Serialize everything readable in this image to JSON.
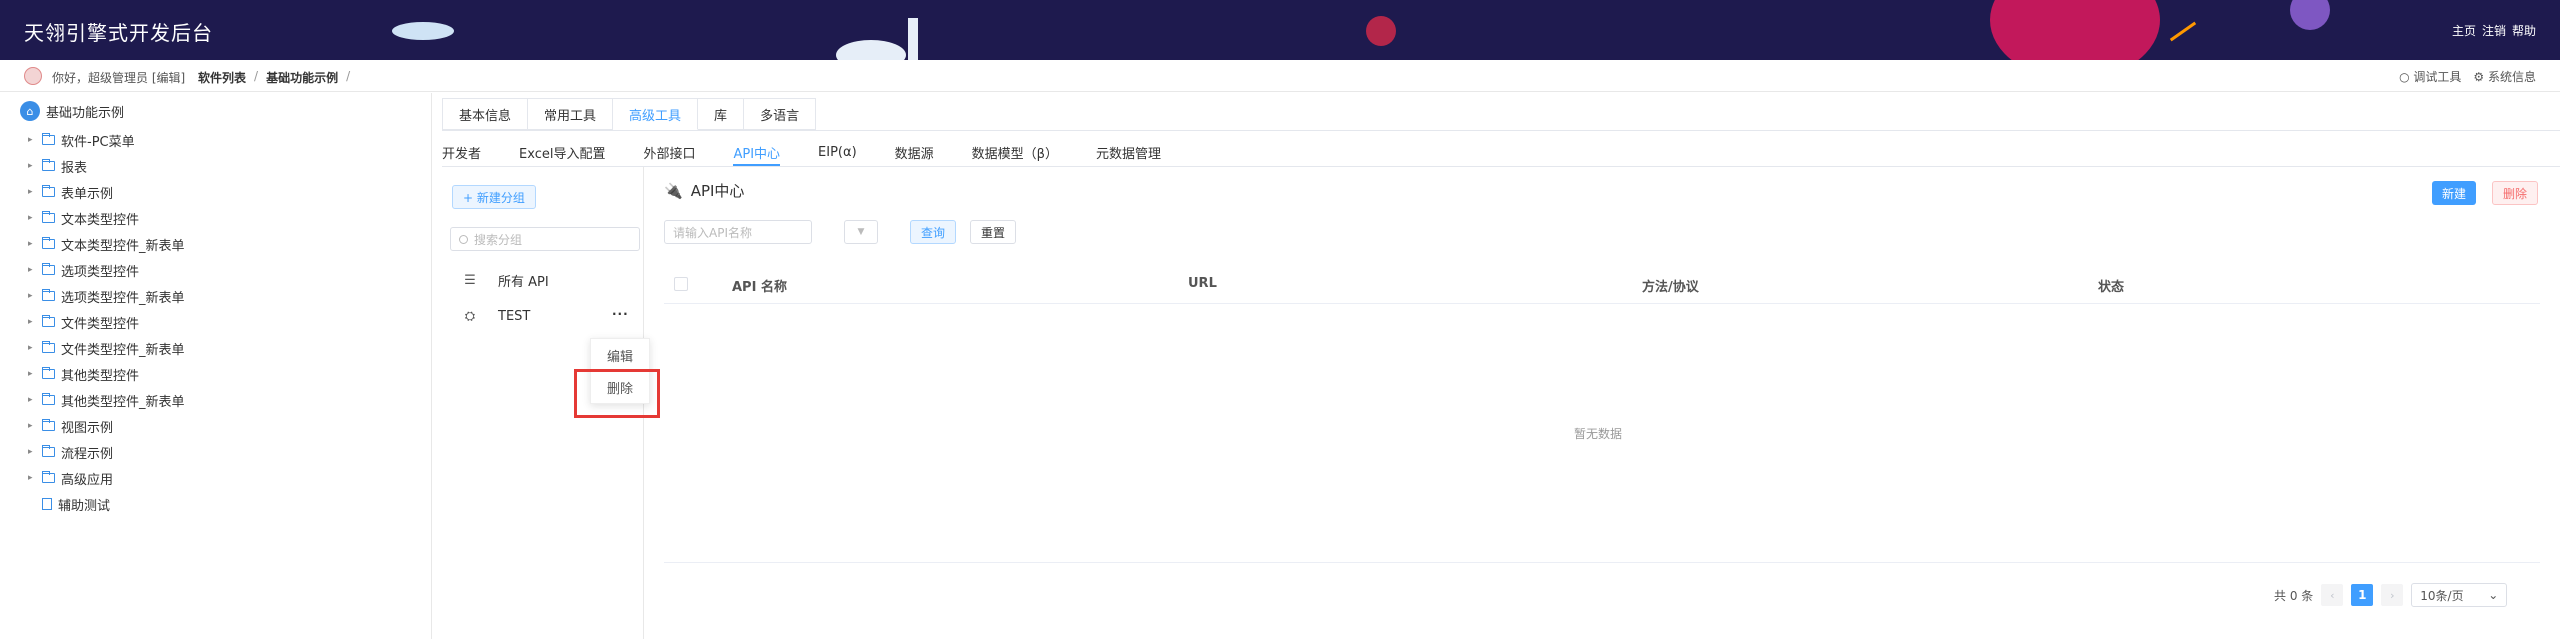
{
  "header": {
    "title": "天翎引擎式开发后台",
    "nav": [
      "主页",
      "注销",
      "帮助"
    ]
  },
  "breadcrumb_bar": {
    "greeting": "你好，超级管理员 [编辑]",
    "crumbs": [
      "软件列表",
      "基础功能示例"
    ],
    "separator": "/",
    "tools": [
      "调试工具",
      "系统信息"
    ]
  },
  "tree": {
    "root": "基础功能示例",
    "items": [
      "软件-PC菜单",
      "报表",
      "表单示例",
      "文本类型控件",
      "文本类型控件_新表单",
      "选项类型控件",
      "选项类型控件_新表单",
      "文件类型控件",
      "文件类型控件_新表单",
      "其他类型控件",
      "其他类型控件_新表单",
      "视图示例",
      "流程示例",
      "高级应用"
    ],
    "leaf": "辅助测试"
  },
  "tabs_primary": [
    "基本信息",
    "常用工具",
    "高级工具",
    "库",
    "多语言"
  ],
  "tabs_primary_active": "高级工具",
  "tabs_secondary": [
    "开发者",
    "Excel导入配置",
    "外部接口",
    "API中心",
    "EIP(α)",
    "数据源",
    "数据模型（β）",
    "元数据管理"
  ],
  "tabs_secondary_active": "API中心",
  "group_panel": {
    "new_group": "+ 新建分组",
    "search_placeholder": "搜索分组",
    "all_api": "所有 API",
    "group_test": "TEST",
    "more": "···",
    "context_menu": [
      "编辑",
      "删除"
    ]
  },
  "main": {
    "title": "API中心",
    "new_button": "新建",
    "delete_button": "删除",
    "search_placeholder": "请输入API名称",
    "query_button": "查询",
    "reset_button": "重置",
    "columns": [
      "API 名称",
      "URL",
      "方法/协议",
      "状态"
    ],
    "empty_text": "暂无数据",
    "pager": {
      "total": "共 0 条",
      "current_page": "1",
      "page_size": "10条/页"
    }
  },
  "colors": {
    "header_bg": "#1e1a4e",
    "accent": "#409eff",
    "danger": "#f56c6c",
    "highlight_box": "#e53935"
  }
}
